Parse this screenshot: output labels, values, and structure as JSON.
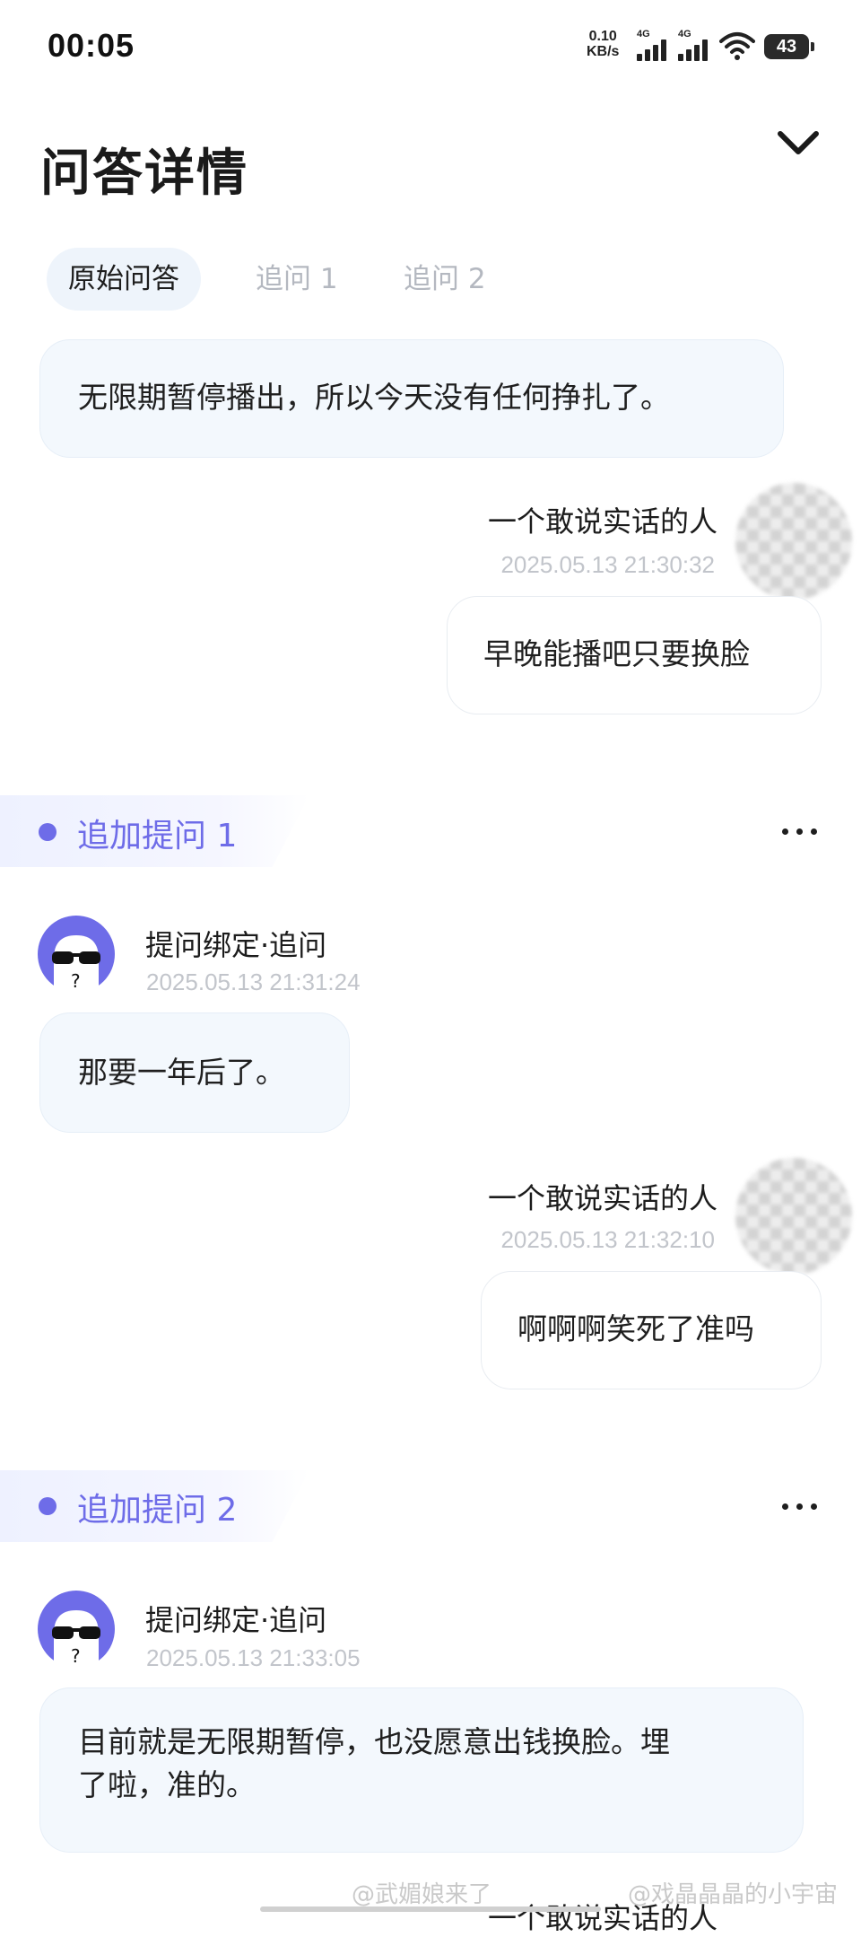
{
  "status_bar": {
    "time": "00:05",
    "net_speed_value": "0.10",
    "net_speed_unit": "KB/s",
    "signal1_label": "4G",
    "signal2_label": "4G",
    "battery": "43"
  },
  "header": {
    "title": "问答详情"
  },
  "tabs": [
    {
      "label": "原始问答",
      "active": true
    },
    {
      "label": "追问 1",
      "active": false
    },
    {
      "label": "追问 2",
      "active": false
    }
  ],
  "original": {
    "bot_message": "无限期暂停播出，所以今天没有任何挣扎了。",
    "user_name": "一个敢说实话的人",
    "user_time": "2025.05.13 21:30:32",
    "user_message": "早晚能播吧只要换脸"
  },
  "followup1": {
    "section_title": "追加提问 1",
    "bot_name": "提问绑定·追问",
    "bot_time": "2025.05.13 21:31:24",
    "bot_message": "那要一年后了。",
    "user_name": "一个敢说实话的人",
    "user_time": "2025.05.13 21:32:10",
    "user_message": "啊啊啊笑死了准吗"
  },
  "followup2": {
    "section_title": "追加提问 2",
    "bot_name": "提问绑定·追问",
    "bot_time": "2025.05.13 21:33:05",
    "bot_message_line1": "目前就是无限期暂停，也没愿意出钱换脸。埋",
    "bot_message_line2": "了啦，准的。",
    "user_name_partial": "一个敢说实话的人"
  },
  "watermarks": [
    "@武媚娘来了",
    "@戏晶晶晶的小宇宙"
  ]
}
